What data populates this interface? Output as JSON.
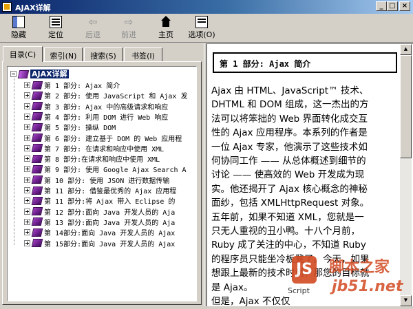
{
  "window": {
    "title": "AJAX详解",
    "min": "_",
    "max": "□",
    "close": "×"
  },
  "toolbar": [
    {
      "label": "隐藏",
      "icon": "hide-icon",
      "enabled": true
    },
    {
      "label": "定位",
      "icon": "locate-icon",
      "enabled": true
    },
    {
      "label": "后退",
      "icon": "back-arrow-icon",
      "enabled": false
    },
    {
      "label": "前进",
      "icon": "forward-arrow-icon",
      "enabled": false
    },
    {
      "label": "主页",
      "icon": "home-icon",
      "enabled": true
    },
    {
      "label": "选项(O)",
      "icon": "options-icon",
      "enabled": true
    }
  ],
  "tabs": [
    {
      "label": "目录(C)",
      "active": true
    },
    {
      "label": "索引(N)",
      "active": false
    },
    {
      "label": "搜索(S)",
      "active": false
    },
    {
      "label": "书签(I)",
      "active": false
    }
  ],
  "tree": {
    "root": "AJAX详解",
    "items": [
      "第 1 部分: Ajax 简介",
      "第 2 部分: 使用 JavaScript 和 Ajax 发",
      "第 3 部分: Ajax 中的高级请求和响应",
      "第 4 部分: 利用 DOM 进行 Web 响应",
      "第 5 部分: 操纵 DOM",
      "第 6 部分: 建立基于 DOM 的 Web 应用程",
      "第 7 部分: 在请求和响应中使用 XML",
      "第 8 部分:在请求和响应中使用 XML",
      "第 9 部分: 使用 Google Ajax Search A",
      "第 10 部分: 使用 JSON 进行数据传输",
      "第 11 部分: 借鉴最优秀的 Ajax 应用程",
      "第 11 部分:将 Ajax 带入 Eclipse 的",
      "第 12 部分:面向 Java 开发人员的 Aja",
      "第 13 部分:面向 Java 开发人员的 Aja",
      "第 14部分:面向 Java 开发人员的 Ajax",
      "第 15部分:面向 Java 开发人员的 Ajax"
    ]
  },
  "article": {
    "title": "第 1 部分: Ajax 简介",
    "lines": [
      "Ajax 由 HTML、JavaScript™ 技术、",
      "DHTML 和 DOM 组成，这一杰出的方",
      "法可以将笨拙的 Web 界面转化成交互",
      "性的 Ajax 应用程序。本系列的作者是",
      "一位 Ajax 专家，他演示了这些技术如",
      "何协同工作 —— 从总体概述到细节的",
      "讨论 —— 使高效的 Web 开发成为现",
      "实。他还揭开了 Ajax 核心概念的神秘",
      "面纱，包括 XMLHttpRequest 对象。",
      "五年前，如果不知道 XML，您就是一",
      "只无人重视的丑小鸭。十八个月前，",
      "Ruby 成了关注的中心，不知道 Ruby",
      "的程序员只能坐冷板凳了。今天，如果",
      "想跟上最新的技术时尚，那您的目标就",
      "是 Ajax。",
      "但是，Ajax 不仅仅"
    ]
  },
  "watermark": {
    "logo": "JS",
    "logo_sub": "Script",
    "cn": "脚本之家",
    "url": "jb51.net"
  }
}
